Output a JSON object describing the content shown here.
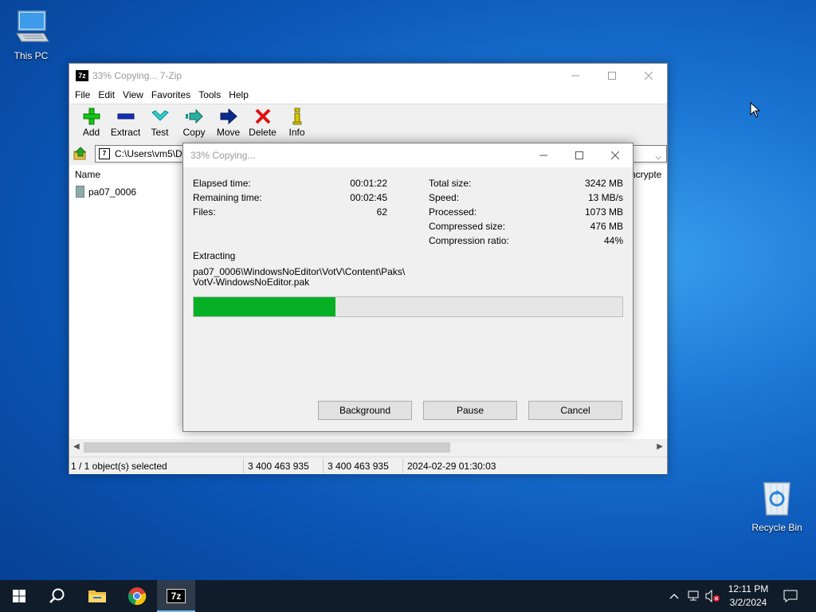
{
  "desktop": {
    "this_pc_label": "This PC",
    "recycle_bin_label": "Recycle Bin"
  },
  "main_window": {
    "title": "33% Copying... 7-Zip",
    "app_icon_text": "7z",
    "menu": [
      "File",
      "Edit",
      "View",
      "Favorites",
      "Tools",
      "Help"
    ],
    "toolbar": {
      "add": "Add",
      "extract": "Extract",
      "test": "Test",
      "copy": "Copy",
      "move": "Move",
      "delete": "Delete",
      "info": "Info"
    },
    "address": "C:\\Users\\vm5\\De",
    "columns": {
      "name": "Name",
      "encrypted_partial": "ncrypte"
    },
    "files": [
      {
        "name": "pa07_0006"
      }
    ],
    "status": {
      "selection": "1 / 1 object(s) selected",
      "size": "3 400 463 935",
      "packed_size": "3 400 463 935",
      "modified": "2024-02-29 01:30:03"
    }
  },
  "progress_dialog": {
    "title": "33% Copying...",
    "elapsed_label": "Elapsed time:",
    "elapsed_value": "00:01:22",
    "remaining_label": "Remaining time:",
    "remaining_value": "00:02:45",
    "files_label": "Files:",
    "files_value": "62",
    "total_size_label": "Total size:",
    "total_size_value": "3242 MB",
    "speed_label": "Speed:",
    "speed_value": "13 MB/s",
    "processed_label": "Processed:",
    "processed_value": "1073 MB",
    "compressed_label": "Compressed size:",
    "compressed_value": "476 MB",
    "ratio_label": "Compression ratio:",
    "ratio_value": "44%",
    "action": "Extracting",
    "path_line1": "pa07_0006\\WindowsNoEditor\\VotV\\Content\\Paks\\",
    "path_line2": "VotV-WindowsNoEditor.pak",
    "progress_fraction": 0.33,
    "buttons": {
      "background": "Background",
      "pause": "Pause",
      "cancel": "Cancel"
    }
  },
  "taskbar": {
    "time": "12:11 PM",
    "date": "3/2/2024",
    "active_app_icon_text": "7z"
  },
  "colors": {
    "progress_green": "#06b025",
    "taskbar_bg": "#101c2a"
  }
}
